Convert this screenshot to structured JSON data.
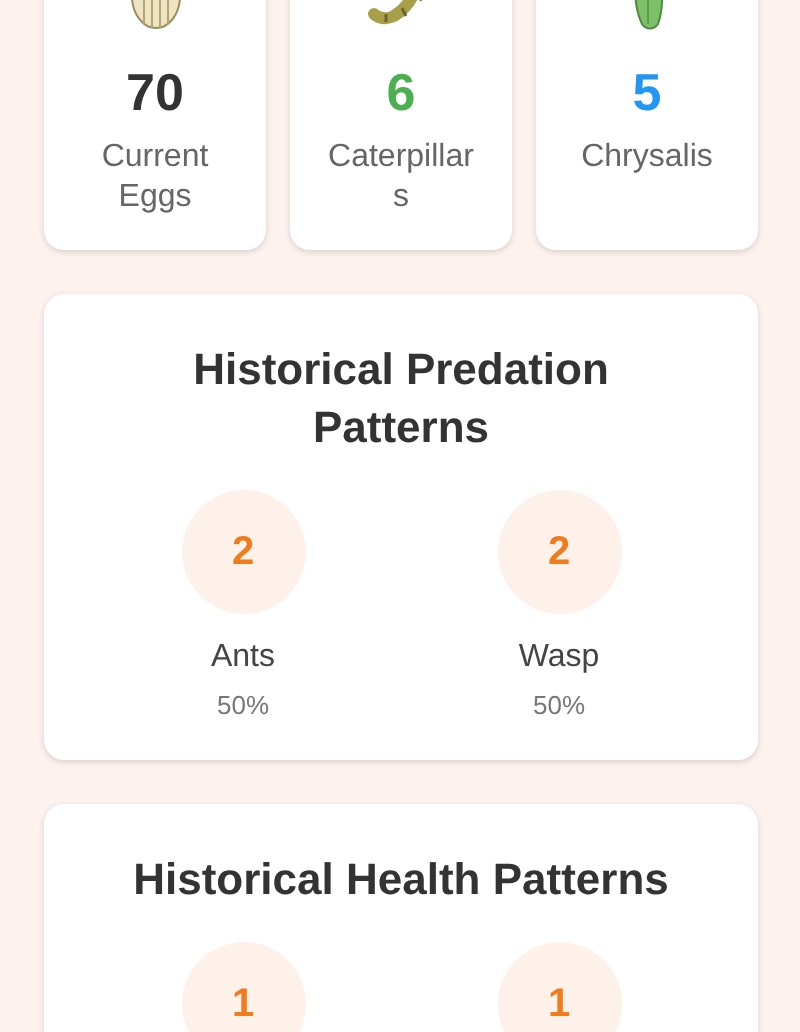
{
  "stats": [
    {
      "kind": "egg",
      "value": "70",
      "label": "Current Eggs",
      "color": "#333333"
    },
    {
      "kind": "caterpillar",
      "value": "6",
      "label": "Caterpillars",
      "color": "#4caf50"
    },
    {
      "kind": "chrysalis",
      "value": "5",
      "label": "Chrysalis",
      "color": "#2196f3"
    }
  ],
  "sections": [
    {
      "title": "Historical Predation Patterns",
      "items": [
        {
          "count": "2",
          "label": "Ants",
          "percent": "50%"
        },
        {
          "count": "2",
          "label": "Wasp",
          "percent": "50%"
        }
      ]
    },
    {
      "title": "Historical Health Patterns",
      "items": [
        {
          "count": "1"
        },
        {
          "count": "1"
        }
      ]
    }
  ]
}
